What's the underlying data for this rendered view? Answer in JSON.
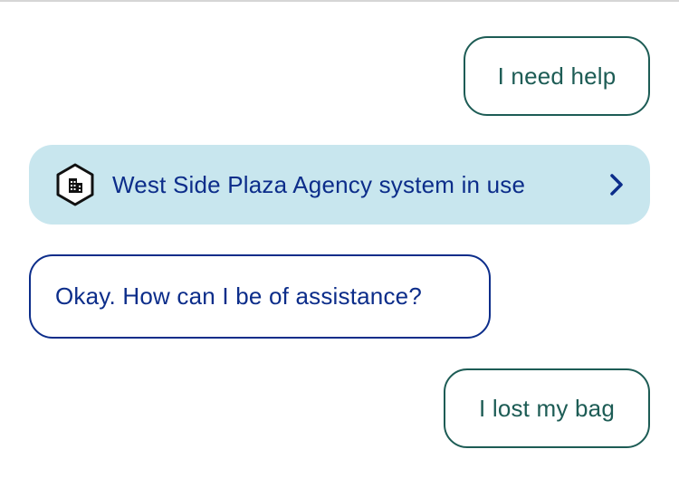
{
  "messages": {
    "user_1": "I need help",
    "agency_system": "West Side Plaza Agency system in use",
    "bot_1": "Okay. How can I be of assistance?",
    "user_2": "I lost my bag"
  },
  "icons": {
    "agency": "building-hexagon-icon",
    "open": "chevron-right-icon"
  },
  "colors": {
    "user_bubble_border": "#1d5c55",
    "bot_text": "#0c2d8a",
    "agency_background": "#c8e6ee"
  }
}
